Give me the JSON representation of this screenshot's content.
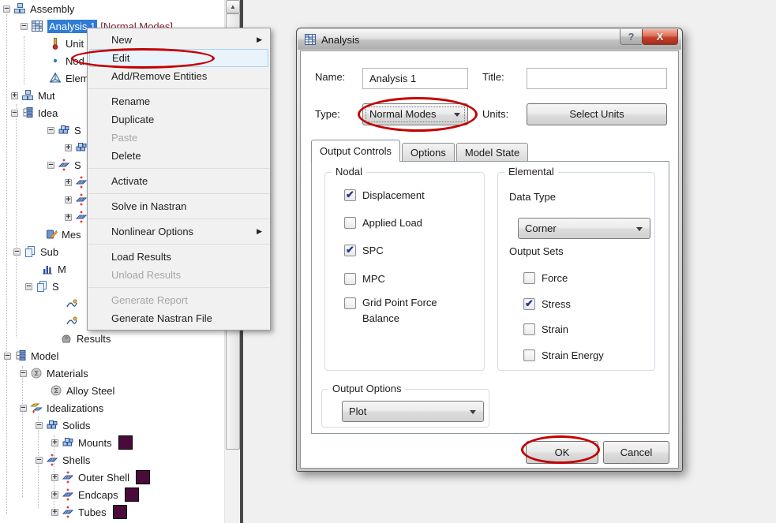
{
  "colors": {
    "selection": "#2E7CD6",
    "analysis_type_text": "#7E2231",
    "swatch": "#4A0A3C",
    "annotation": "#C40000"
  },
  "tree": {
    "rows": [
      {
        "label": "Assembly",
        "icon": "assembly-blocks-icon",
        "exp": "minus",
        "x": 4
      },
      {
        "label": "Analysis 1",
        "suffix": "[Normal Modes]",
        "icon": "analysis-grid-icon",
        "exp": "minus",
        "x": 26,
        "selected": true
      },
      {
        "label": "Unit",
        "icon": "thermometer-icon",
        "x": 62
      },
      {
        "label": "Nod",
        "icon": "node-dot-icon",
        "x": 62
      },
      {
        "label": "Elem",
        "icon": "element-tetra-icon",
        "x": 62
      },
      {
        "label": "Mut",
        "icon": "assembly-blocks-icon",
        "exp": "plus",
        "x": 14
      },
      {
        "label": "Idea",
        "icon": "hierarchy-icon",
        "exp": "minus",
        "x": 14
      },
      {
        "label": "S",
        "icon": "solids-icon",
        "exp": "minus",
        "x": 60
      },
      {
        "label": "",
        "icon": "solids-icon",
        "exp": "plus",
        "x": 82
      },
      {
        "label": "S",
        "icon": "shells-icon",
        "exp": "minus",
        "x": 60
      },
      {
        "label": "",
        "icon": "shells-icon",
        "exp": "plus",
        "x": 82
      },
      {
        "label": "",
        "icon": "shells-icon",
        "exp": "plus",
        "x": 82
      },
      {
        "label": "",
        "icon": "shells-icon",
        "exp": "plus",
        "x": 82
      },
      {
        "label": "Mes",
        "icon": "mesh-icon",
        "x": 57
      },
      {
        "label": "Sub",
        "icon": "pages-icon",
        "exp": "minus",
        "x": 17
      },
      {
        "label": "M",
        "icon": "bar-chart-icon",
        "x": 52
      },
      {
        "label": "S",
        "icon": "pages-icon",
        "exp": "minus",
        "x": 32
      },
      {
        "label": "",
        "icon": "mode-shape-icon",
        "x": 83
      },
      {
        "label": "",
        "icon": "mode-shape-icon",
        "x": 83
      },
      {
        "label": "Results",
        "icon": "results-icon",
        "x": 76
      },
      {
        "label": "Model",
        "icon": "hierarchy-icon",
        "exp": "minus",
        "x": 5
      },
      {
        "label": "Materials",
        "icon": "materials-sphere-icon",
        "exp": "minus",
        "x": 25
      },
      {
        "label": "Alloy Steel",
        "icon": "materials-sphere-icon",
        "x": 63
      },
      {
        "label": "Idealizations",
        "icon": "idealizations-icon",
        "exp": "minus",
        "x": 25
      },
      {
        "label": "Solids",
        "icon": "solids-icon",
        "exp": "minus",
        "x": 45
      },
      {
        "label": "Mounts",
        "icon": "solids-icon",
        "exp": "plus",
        "x": 65,
        "swatch": true
      },
      {
        "label": "Shells",
        "icon": "shells-icon",
        "exp": "minus",
        "x": 45
      },
      {
        "label": "Outer Shell",
        "icon": "shells-icon",
        "exp": "plus",
        "x": 65,
        "swatch": true
      },
      {
        "label": "Endcaps",
        "icon": "shells-icon",
        "exp": "plus",
        "x": 65,
        "swatch": true
      },
      {
        "label": "Tubes",
        "icon": "shells-icon",
        "exp": "plus",
        "x": 65,
        "swatch": true
      }
    ]
  },
  "menu": {
    "items": [
      {
        "label": "New",
        "submenu": true
      },
      {
        "label": "Edit",
        "highlighted": true
      },
      {
        "label": "Add/Remove Entities"
      },
      {
        "sep": true
      },
      {
        "label": "Rename"
      },
      {
        "label": "Duplicate"
      },
      {
        "label": "Paste",
        "disabled": true
      },
      {
        "label": "Delete"
      },
      {
        "sep": true
      },
      {
        "label": "Activate"
      },
      {
        "sep": true
      },
      {
        "label": "Solve in Nastran"
      },
      {
        "sep": true
      },
      {
        "label": "Nonlinear Options",
        "submenu": true
      },
      {
        "sep": true
      },
      {
        "label": "Load Results"
      },
      {
        "label": "Unload Results",
        "disabled": true
      },
      {
        "sep": true
      },
      {
        "label": "Generate Report",
        "disabled": true
      },
      {
        "label": "Generate Nastran File"
      }
    ]
  },
  "dialog": {
    "title": "Analysis",
    "help_glyph": "?",
    "close_glyph": "X",
    "name_label": "Name:",
    "name_value": "Analysis 1",
    "title_label": "Title:",
    "title_value": "",
    "type_label": "Type:",
    "type_value": "Normal Modes",
    "units_label": "Units:",
    "units_button": "Select Units",
    "tabs": [
      "Output Controls",
      "Options",
      "Model State"
    ],
    "active_tab": 0,
    "nodal": {
      "legend": "Nodal",
      "checkboxes": [
        {
          "label": "Displacement",
          "checked": true
        },
        {
          "label": "Applied Load",
          "checked": false
        },
        {
          "label": "SPC",
          "checked": true
        },
        {
          "label": "MPC",
          "checked": false
        },
        {
          "label": "Grid Point Force Balance",
          "checked": false,
          "wrap": true
        }
      ]
    },
    "elemental": {
      "legend": "Elemental",
      "data_type_label": "Data Type",
      "data_type_value": "Corner",
      "output_sets_label": "Output Sets",
      "checkboxes": [
        {
          "label": "Force",
          "checked": false
        },
        {
          "label": "Stress",
          "checked": true
        },
        {
          "label": "Strain",
          "checked": false
        },
        {
          "label": "Strain Energy",
          "checked": false
        }
      ]
    },
    "output_options": {
      "legend": "Output Options",
      "value": "Plot"
    },
    "ok_button": "OK",
    "cancel_button": "Cancel"
  }
}
